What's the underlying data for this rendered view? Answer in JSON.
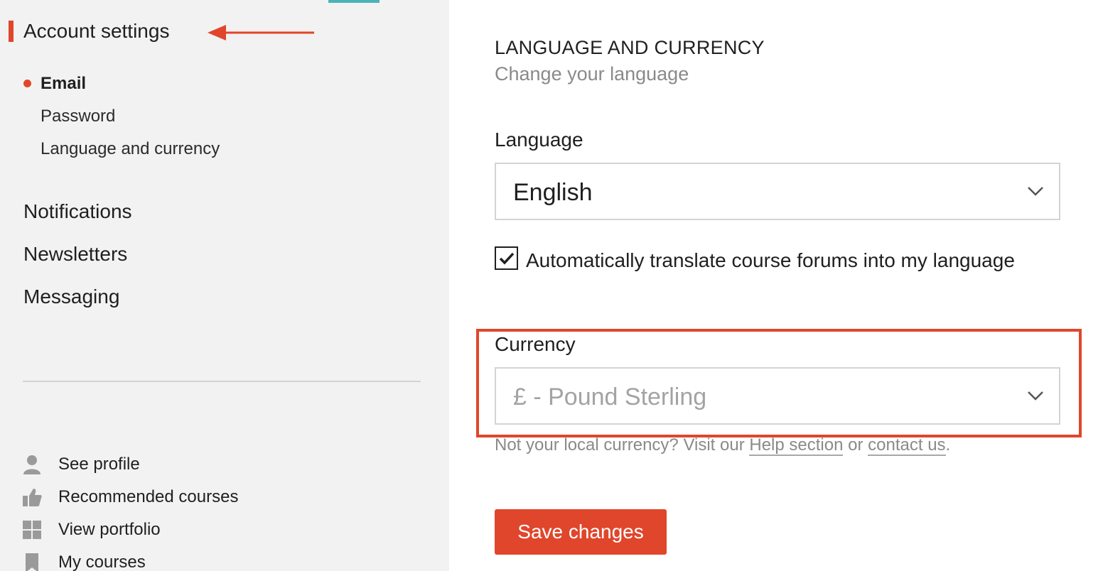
{
  "sidebar": {
    "section_title": "Account settings",
    "sub_items": [
      {
        "label": "Email",
        "active": true
      },
      {
        "label": "Password",
        "active": false
      },
      {
        "label": "Language and currency",
        "active": false
      }
    ],
    "nav_items": [
      {
        "label": "Notifications"
      },
      {
        "label": "Newsletters"
      },
      {
        "label": "Messaging"
      }
    ],
    "links": [
      {
        "label": "See profile",
        "icon": "person-icon"
      },
      {
        "label": "Recommended courses",
        "icon": "thumbs-up-icon"
      },
      {
        "label": "View portfolio",
        "icon": "grid-icon"
      },
      {
        "label": "My courses",
        "icon": "bookmark-icon"
      }
    ]
  },
  "main": {
    "heading": "LANGUAGE AND CURRENCY",
    "subheading": "Change your language",
    "language": {
      "label": "Language",
      "value": "English"
    },
    "auto_translate": {
      "checked": true,
      "label": "Automatically translate course forums into my language"
    },
    "currency": {
      "label": "Currency",
      "value": "£ - Pound Sterling"
    },
    "help": {
      "prefix": "Not your local currency? Visit our ",
      "help_link": "Help section",
      "middle": " or ",
      "contact_link": "contact us",
      "suffix": "."
    },
    "save_label": "Save changes"
  },
  "colors": {
    "accent": "#e0462b",
    "sidebar_bg": "#f2f2f2",
    "tab_teal": "#4ab3b8"
  }
}
